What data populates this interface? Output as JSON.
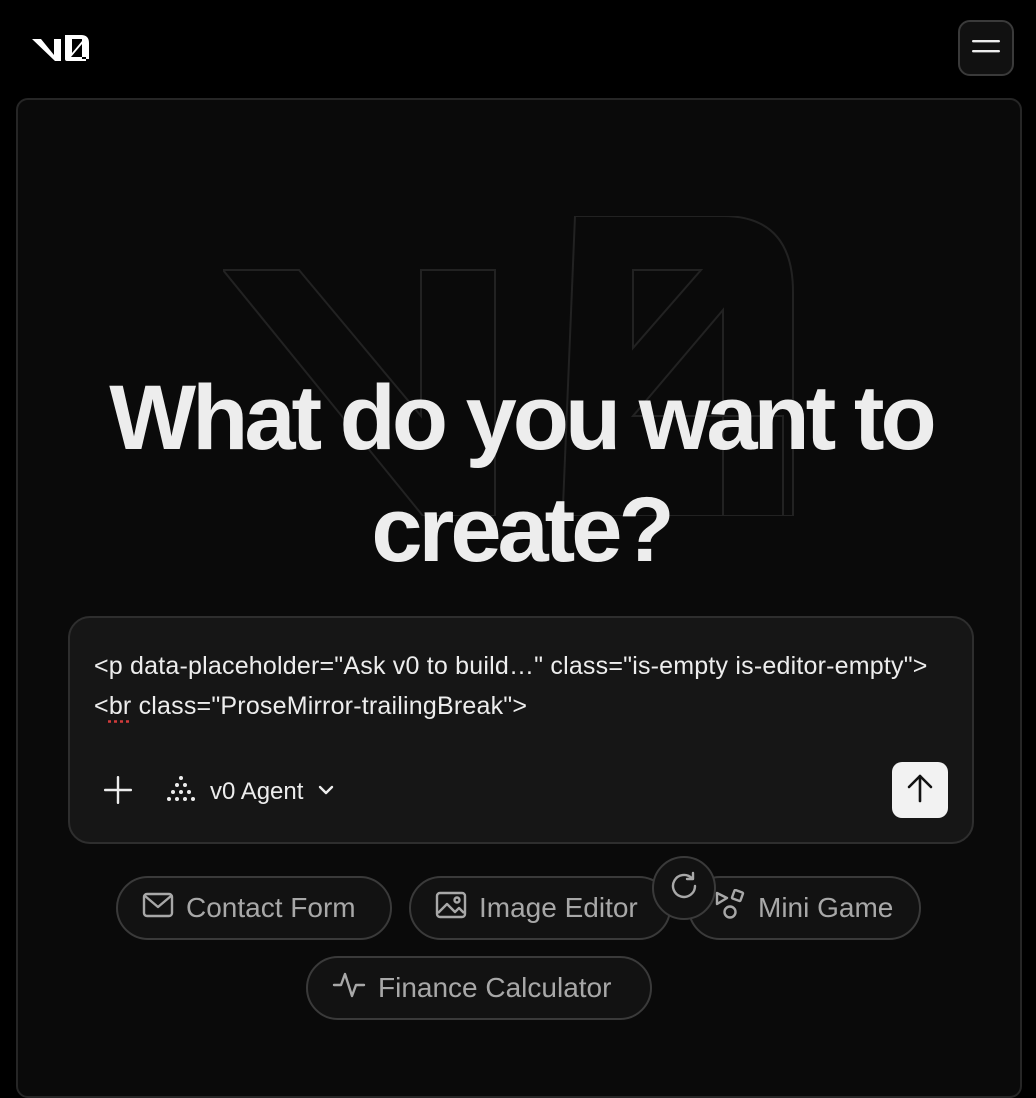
{
  "header": {
    "logo_text": "v0",
    "menu_icon": "hamburger-menu-icon"
  },
  "hero": {
    "headline_line1": "What do you want to",
    "headline_line2": "create?"
  },
  "prompt": {
    "text_part1": "<p data-placeholder=\"Ask v0 to build…\" class=\"is-empty is-editor-empty\"><",
    "text_squiggle": "br",
    "text_part2": " class=\"ProseMirror-trailingBreak\">",
    "add_icon": "plus-icon",
    "agent_label": "v0 Agent",
    "agent_icon": "dots-triangle-icon",
    "send_icon": "arrow-up-icon"
  },
  "suggestions": [
    {
      "label": "Contact Form",
      "icon": "mail-icon"
    },
    {
      "label": "Image Editor",
      "icon": "image-icon"
    },
    {
      "label": "Mini Game",
      "icon": "shapes-icon"
    },
    {
      "label": "Finance Calculator",
      "icon": "activity-icon"
    }
  ],
  "refresh_icon": "refresh-icon",
  "colors": {
    "background": "#000000",
    "panel": "#0a0a0a",
    "text": "#ededed",
    "muted": "#a8a8a8",
    "send_button": "#f2f2f2"
  }
}
